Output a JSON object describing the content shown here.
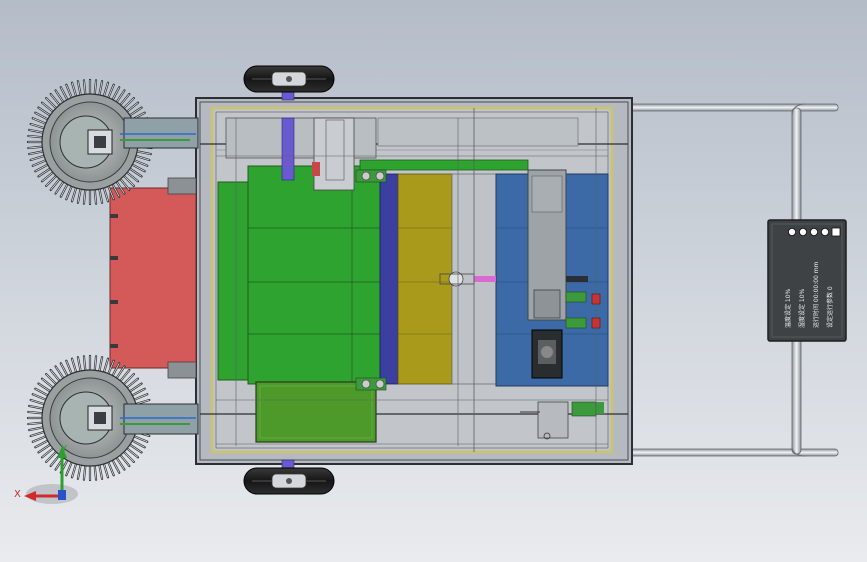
{
  "viewport": {
    "background_top": "#b4bcc8",
    "background_bottom": "#e9ebee"
  },
  "control_panel": {
    "button_count": 4,
    "display_lines": [
      "温度设定 10%",
      "湿度设定 10%",
      "运行时间 00:00:00 mm",
      "设定运行参数 0"
    ]
  },
  "triad": {
    "x_label": "X",
    "y_label": "Y"
  },
  "colors": {
    "frame_outline": "#2b2f33",
    "frame_inner": "#c9c27a",
    "green_panel": "#2fa32f",
    "olive_panel": "#a99a1c",
    "blue_panel": "#3b6aa6",
    "red_panel": "#d45a5a",
    "purple_axis": "#6a5ad0",
    "wheel_fill": "#a3a8a7",
    "tire": "#1b1b1b",
    "handle": "#c8ccd0"
  }
}
